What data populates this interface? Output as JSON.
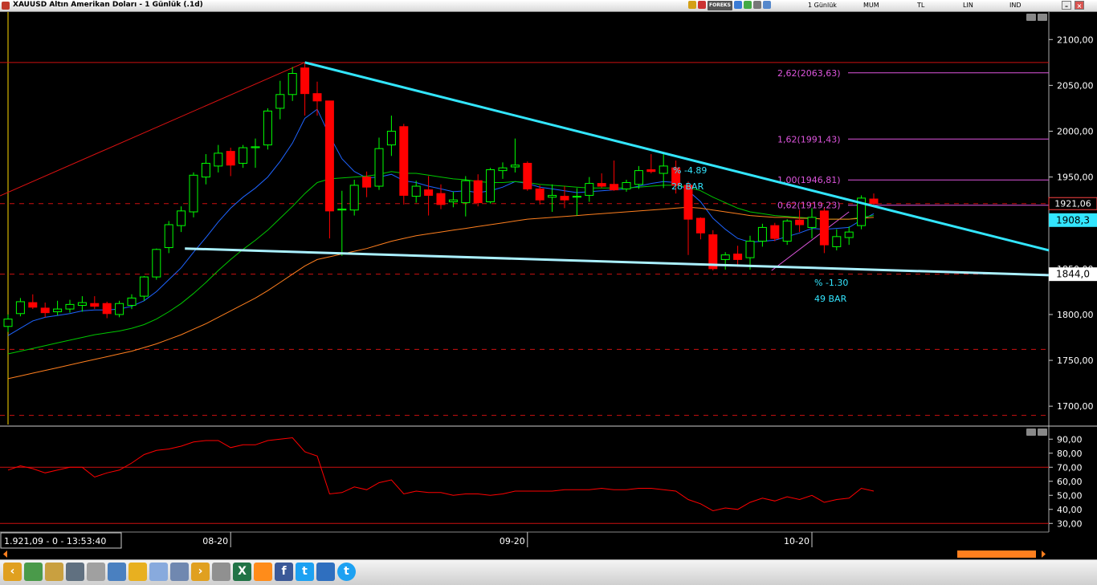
{
  "window": {
    "title": "XAUUSD Altın Amerikan Doları - 1 Günlük (.1d)"
  },
  "toolbar": {
    "forex_label": "FOREKS",
    "period": "1 Günlük",
    "chart_style": "MUM",
    "currency": "TL",
    "scale": "LIN",
    "indicator": "IND",
    "minimize": "–",
    "close": "×"
  },
  "status": {
    "readout": "1.921,09 - 0 - 13:53:40"
  },
  "fib_labels": [
    "2,62(2063,63)",
    "1,62(1991,43)",
    "1,00(1946,81)",
    "0,62(1919,23)"
  ],
  "annotations": {
    "pct_top": "% -4.89",
    "bars_top": "28 BAR",
    "pct_bottom": "% -1.30",
    "bars_bottom": "49 BAR"
  },
  "price_tags": {
    "last_price": "1921,06",
    "trend_upper": "1908,3",
    "trend_lower": "1844,0"
  },
  "colors": {
    "up": "#00ff00",
    "down": "#ff0000",
    "ma_fast": "#1e64ff",
    "ma_mid": "#00c800",
    "ma_slow": "#ff7f1e",
    "trend": "#33e6ff",
    "fib": "#dd55dd",
    "rsi": "#ff0000"
  },
  "chart_data": {
    "type": "candlestick",
    "symbol": "XAUUSD",
    "timeframe": "1d",
    "ylim": [
      1680,
      2130
    ],
    "yticks": [
      1700,
      1750,
      1800,
      1850,
      1900,
      1950,
      2000,
      2050,
      2100
    ],
    "ytick_labels": [
      "1700,00",
      "1750,00",
      "1800,00",
      "1850,00",
      "1900,00",
      "1950,00",
      "2000,00",
      "2050,00",
      "2100,00"
    ],
    "xtick_labels": [
      "08-20",
      "09-20",
      "10-20"
    ],
    "xtick_index": [
      18,
      42,
      65
    ],
    "candles": [
      {
        "o": 1787,
        "h": 1800,
        "l": 1781,
        "c": 1795
      },
      {
        "o": 1801,
        "h": 1818,
        "l": 1798,
        "c": 1814
      },
      {
        "o": 1813,
        "h": 1822,
        "l": 1806,
        "c": 1808
      },
      {
        "o": 1807,
        "h": 1813,
        "l": 1797,
        "c": 1802
      },
      {
        "o": 1803,
        "h": 1815,
        "l": 1799,
        "c": 1806
      },
      {
        "o": 1806,
        "h": 1816,
        "l": 1802,
        "c": 1811
      },
      {
        "o": 1810,
        "h": 1820,
        "l": 1803,
        "c": 1813
      },
      {
        "o": 1812,
        "h": 1820,
        "l": 1806,
        "c": 1809
      },
      {
        "o": 1812,
        "h": 1814,
        "l": 1796,
        "c": 1801
      },
      {
        "o": 1800,
        "h": 1815,
        "l": 1797,
        "c": 1812
      },
      {
        "o": 1810,
        "h": 1822,
        "l": 1806,
        "c": 1818
      },
      {
        "o": 1820,
        "h": 1842,
        "l": 1815,
        "c": 1841
      },
      {
        "o": 1841,
        "h": 1872,
        "l": 1838,
        "c": 1871
      },
      {
        "o": 1873,
        "h": 1902,
        "l": 1867,
        "c": 1898
      },
      {
        "o": 1897,
        "h": 1918,
        "l": 1890,
        "c": 1913
      },
      {
        "o": 1912,
        "h": 1955,
        "l": 1906,
        "c": 1952
      },
      {
        "o": 1950,
        "h": 1975,
        "l": 1942,
        "c": 1965
      },
      {
        "o": 1962,
        "h": 1985,
        "l": 1955,
        "c": 1976
      },
      {
        "o": 1978,
        "h": 1982,
        "l": 1951,
        "c": 1963
      },
      {
        "o": 1965,
        "h": 1985,
        "l": 1960,
        "c": 1982
      },
      {
        "o": 1982,
        "h": 1992,
        "l": 1960,
        "c": 1983
      },
      {
        "o": 1985,
        "h": 2025,
        "l": 1980,
        "c": 2022
      },
      {
        "o": 2025,
        "h": 2055,
        "l": 2013,
        "c": 2040
      },
      {
        "o": 2040,
        "h": 2070,
        "l": 2033,
        "c": 2063
      },
      {
        "o": 2069,
        "h": 2075,
        "l": 2017,
        "c": 2041
      },
      {
        "o": 2041,
        "h": 2054,
        "l": 2017,
        "c": 2033
      },
      {
        "o": 2033,
        "h": 2033,
        "l": 1883,
        "c": 1913
      },
      {
        "o": 1914,
        "h": 1935,
        "l": 1864,
        "c": 1915
      },
      {
        "o": 1914,
        "h": 1947,
        "l": 1908,
        "c": 1941
      },
      {
        "o": 1950,
        "h": 1956,
        "l": 1928,
        "c": 1939
      },
      {
        "o": 1940,
        "h": 1993,
        "l": 1936,
        "c": 1981
      },
      {
        "o": 1985,
        "h": 2017,
        "l": 1973,
        "c": 2000
      },
      {
        "o": 2005,
        "h": 2008,
        "l": 1920,
        "c": 1930
      },
      {
        "o": 1929,
        "h": 1946,
        "l": 1922,
        "c": 1940
      },
      {
        "o": 1936,
        "h": 1951,
        "l": 1908,
        "c": 1930
      },
      {
        "o": 1932,
        "h": 1942,
        "l": 1915,
        "c": 1920
      },
      {
        "o": 1923,
        "h": 1934,
        "l": 1917,
        "c": 1925
      },
      {
        "o": 1922,
        "h": 1951,
        "l": 1907,
        "c": 1946
      },
      {
        "o": 1946,
        "h": 1953,
        "l": 1918,
        "c": 1922
      },
      {
        "o": 1923,
        "h": 1960,
        "l": 1921,
        "c": 1958
      },
      {
        "o": 1957,
        "h": 1966,
        "l": 1948,
        "c": 1960
      },
      {
        "o": 1961,
        "h": 1992,
        "l": 1955,
        "c": 1963
      },
      {
        "o": 1965,
        "h": 1967,
        "l": 1935,
        "c": 1937
      },
      {
        "o": 1937,
        "h": 1941,
        "l": 1920,
        "c": 1925
      },
      {
        "o": 1928,
        "h": 1942,
        "l": 1912,
        "c": 1930
      },
      {
        "o": 1929,
        "h": 1940,
        "l": 1916,
        "c": 1925
      },
      {
        "o": 1928,
        "h": 1938,
        "l": 1908,
        "c": 1929
      },
      {
        "o": 1930,
        "h": 1950,
        "l": 1923,
        "c": 1943
      },
      {
        "o": 1943,
        "h": 1954,
        "l": 1938,
        "c": 1940
      },
      {
        "o": 1942,
        "h": 1968,
        "l": 1935,
        "c": 1936
      },
      {
        "o": 1937,
        "h": 1947,
        "l": 1934,
        "c": 1944
      },
      {
        "o": 1942,
        "h": 1962,
        "l": 1937,
        "c": 1957
      },
      {
        "o": 1958,
        "h": 1975,
        "l": 1954,
        "c": 1956
      },
      {
        "o": 1954,
        "h": 1975,
        "l": 1938,
        "c": 1962
      },
      {
        "o": 1960,
        "h": 1968,
        "l": 1932,
        "c": 1941
      },
      {
        "o": 1941,
        "h": 1945,
        "l": 1865,
        "c": 1904
      },
      {
        "o": 1905,
        "h": 1906,
        "l": 1882,
        "c": 1889
      },
      {
        "o": 1887,
        "h": 1892,
        "l": 1848,
        "c": 1850
      },
      {
        "o": 1860,
        "h": 1868,
        "l": 1849,
        "c": 1865
      },
      {
        "o": 1866,
        "h": 1875,
        "l": 1852,
        "c": 1860
      },
      {
        "o": 1862,
        "h": 1886,
        "l": 1849,
        "c": 1880
      },
      {
        "o": 1880,
        "h": 1899,
        "l": 1874,
        "c": 1895
      },
      {
        "o": 1897,
        "h": 1900,
        "l": 1880,
        "c": 1883
      },
      {
        "o": 1880,
        "h": 1904,
        "l": 1876,
        "c": 1902
      },
      {
        "o": 1903,
        "h": 1914,
        "l": 1890,
        "c": 1898
      },
      {
        "o": 1895,
        "h": 1916,
        "l": 1883,
        "c": 1906
      },
      {
        "o": 1913,
        "h": 1916,
        "l": 1867,
        "c": 1876
      },
      {
        "o": 1874,
        "h": 1893,
        "l": 1870,
        "c": 1885
      },
      {
        "o": 1884,
        "h": 1896,
        "l": 1876,
        "c": 1890
      },
      {
        "o": 1897,
        "h": 1930,
        "l": 1893,
        "c": 1927
      },
      {
        "o": 1926,
        "h": 1932,
        "l": 1919,
        "c": 1921
      }
    ],
    "ma_fast": [
      1777,
      1785,
      1793,
      1797,
      1799,
      1801,
      1804,
      1805,
      1805,
      1806,
      1809,
      1815,
      1825,
      1838,
      1851,
      1868,
      1884,
      1901,
      1916,
      1928,
      1938,
      1950,
      1967,
      1987,
      2014,
      2024,
      1995,
      1970,
      1956,
      1949,
      1950,
      1953,
      1946,
      1944,
      1940,
      1937,
      1934,
      1935,
      1933,
      1935,
      1939,
      1945,
      1943,
      1939,
      1937,
      1935,
      1933,
      1934,
      1935,
      1936,
      1937,
      1940,
      1943,
      1945,
      1944,
      1935,
      1923,
      1905,
      1893,
      1883,
      1879,
      1880,
      1881,
      1885,
      1889,
      1894,
      1893,
      1894,
      1895,
      1903,
      1910
    ],
    "ma_mid": [
      1757,
      1760,
      1763,
      1766,
      1769,
      1772,
      1775,
      1778,
      1780,
      1782,
      1785,
      1789,
      1795,
      1803,
      1812,
      1823,
      1835,
      1848,
      1860,
      1871,
      1881,
      1892,
      1905,
      1918,
      1932,
      1944,
      1948,
      1949,
      1950,
      1951,
      1953,
      1956,
      1954,
      1954,
      1952,
      1950,
      1948,
      1947,
      1945,
      1944,
      1944,
      1945,
      1944,
      1942,
      1941,
      1940,
      1939,
      1938,
      1938,
      1938,
      1938,
      1939,
      1940,
      1941,
      1941,
      1939,
      1935,
      1928,
      1922,
      1916,
      1912,
      1910,
      1908,
      1907,
      1906,
      1905,
      1904,
      1904,
      1904,
      1906,
      1908
    ],
    "ma_slow": [
      1730,
      1733,
      1736,
      1739,
      1742,
      1745,
      1748,
      1751,
      1754,
      1757,
      1760,
      1764,
      1768,
      1773,
      1778,
      1784,
      1790,
      1797,
      1804,
      1811,
      1818,
      1826,
      1835,
      1844,
      1853,
      1860,
      1863,
      1866,
      1869,
      1872,
      1876,
      1880,
      1883,
      1886,
      1888,
      1890,
      1892,
      1894,
      1896,
      1898,
      1900,
      1902,
      1904,
      1905,
      1906,
      1907,
      1908,
      1909,
      1910,
      1911,
      1912,
      1913,
      1914,
      1915,
      1916,
      1917,
      1916,
      1914,
      1912,
      1910,
      1908,
      1907,
      1906,
      1906,
      1905,
      1905,
      1904,
      1904,
      1904,
      1905,
      1906
    ],
    "trendline_upper": {
      "from_index": 24,
      "from_price": 2075,
      "to_index": 82,
      "to_price": 1870
    },
    "trendline_lower": {
      "from_index": 13,
      "from_price": 1872,
      "to_index": 82,
      "to_price": 1843
    },
    "fib_levels": [
      2063.63,
      1991.43,
      1946.81,
      1919.23
    ],
    "horizontal_lines": [
      2075,
      1921,
      1844,
      1762,
      1690
    ],
    "rsi": {
      "ylim": [
        25,
        97
      ],
      "yticks": [
        30,
        40,
        50,
        60,
        70,
        80,
        90
      ],
      "ytick_labels": [
        "30,00",
        "40,00",
        "50,00",
        "60,00",
        "70,00",
        "80,00",
        "90,00"
      ],
      "levels": [
        70,
        30
      ],
      "values": [
        68,
        71,
        69,
        66,
        68,
        70,
        70,
        63,
        66,
        68,
        73,
        79,
        82,
        83,
        85,
        88,
        89,
        89,
        84,
        86,
        86,
        89,
        90,
        91,
        81,
        78,
        51,
        52,
        56,
        54,
        59,
        61,
        51,
        53,
        52,
        52,
        50,
        51,
        51,
        50,
        51,
        53,
        53,
        53,
        53,
        54,
        54,
        54,
        55,
        54,
        54,
        55,
        55,
        54,
        53,
        47,
        44,
        39,
        41,
        40,
        45,
        48,
        46,
        49,
        47,
        50,
        45,
        47,
        48,
        55,
        53
      ]
    }
  }
}
